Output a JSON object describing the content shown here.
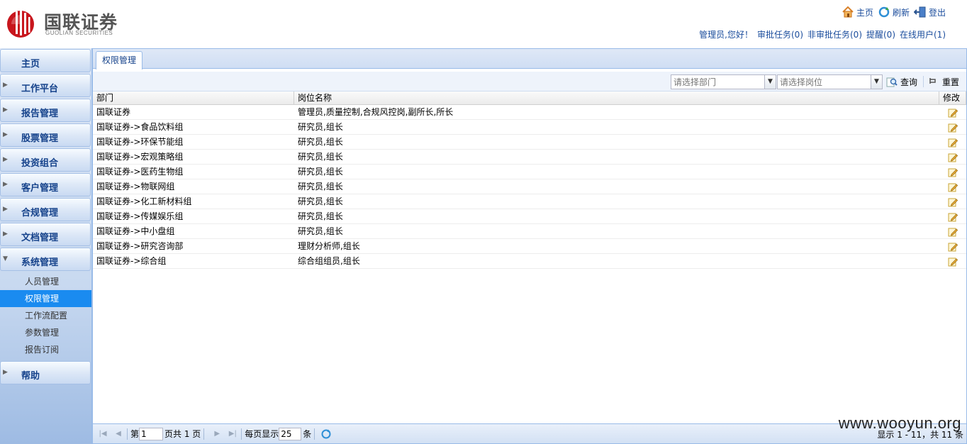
{
  "brand": {
    "name_cn": "国联证券",
    "name_en": "GUOLIAN SECURITIES",
    "color": "#c8161d"
  },
  "top_links": [
    {
      "label": "主页",
      "icon": "home-icon"
    },
    {
      "label": "刷新",
      "icon": "refresh-icon"
    },
    {
      "label": "登出",
      "icon": "logout-icon"
    }
  ],
  "user_bar": {
    "greeting": "管理员,您好！",
    "approval_tasks": "审批任务(0)",
    "non_approval_tasks": "非审批任务(0)",
    "reminders": "提醒(0)",
    "online_users": "在线用户(1)"
  },
  "sidebar": {
    "items": [
      {
        "label": "主页",
        "arrow": ""
      },
      {
        "label": "工作平台",
        "arrow": "▶"
      },
      {
        "label": "报告管理",
        "arrow": "▶"
      },
      {
        "label": "股票管理",
        "arrow": "▶"
      },
      {
        "label": "投资组合",
        "arrow": "▶"
      },
      {
        "label": "客户管理",
        "arrow": "▶"
      },
      {
        "label": "合规管理",
        "arrow": "▶"
      },
      {
        "label": "文档管理",
        "arrow": "▶"
      },
      {
        "label": "系统管理",
        "arrow": "▼"
      },
      {
        "label": "帮助",
        "arrow": "▶"
      }
    ],
    "sub_items": [
      "人员管理",
      "权限管理",
      "工作流配置",
      "参数管理",
      "报告订阅"
    ],
    "active_sub": "权限管理"
  },
  "tab": {
    "label": "权限管理"
  },
  "toolbar": {
    "dept_placeholder": "请选择部门",
    "position_placeholder": "请选择岗位",
    "query_label": "查询",
    "reset_label": "重置"
  },
  "grid": {
    "columns": [
      "部门",
      "岗位名称",
      "修改"
    ],
    "rows": [
      {
        "dept": "国联证券",
        "positions": "管理员,质量控制,合规风控岗,副所长,所长"
      },
      {
        "dept": "国联证券->食品饮料组",
        "positions": "研究员,组长"
      },
      {
        "dept": "国联证券->环保节能组",
        "positions": "研究员,组长"
      },
      {
        "dept": "国联证券->宏观策略组",
        "positions": "研究员,组长"
      },
      {
        "dept": "国联证券->医药生物组",
        "positions": "研究员,组长"
      },
      {
        "dept": "国联证券->物联网组",
        "positions": "研究员,组长"
      },
      {
        "dept": "国联证券->化工新材料组",
        "positions": "研究员,组长"
      },
      {
        "dept": "国联证券->传媒娱乐组",
        "positions": "研究员,组长"
      },
      {
        "dept": "国联证券->中小盘组",
        "positions": "研究员,组长"
      },
      {
        "dept": "国联证券->研究咨询部",
        "positions": "理财分析师,组长"
      },
      {
        "dept": "国联证券->综合组",
        "positions": "综合组组员,组长"
      }
    ]
  },
  "pager": {
    "page_prefix": "第",
    "page_value": "1",
    "page_suffix": "页共 1 页",
    "per_page_prefix": "每页显示",
    "per_page_value": "25",
    "per_page_suffix": "条",
    "info": "显示 1 - 11，共 11 条"
  },
  "watermark": "www.wooyun.org"
}
